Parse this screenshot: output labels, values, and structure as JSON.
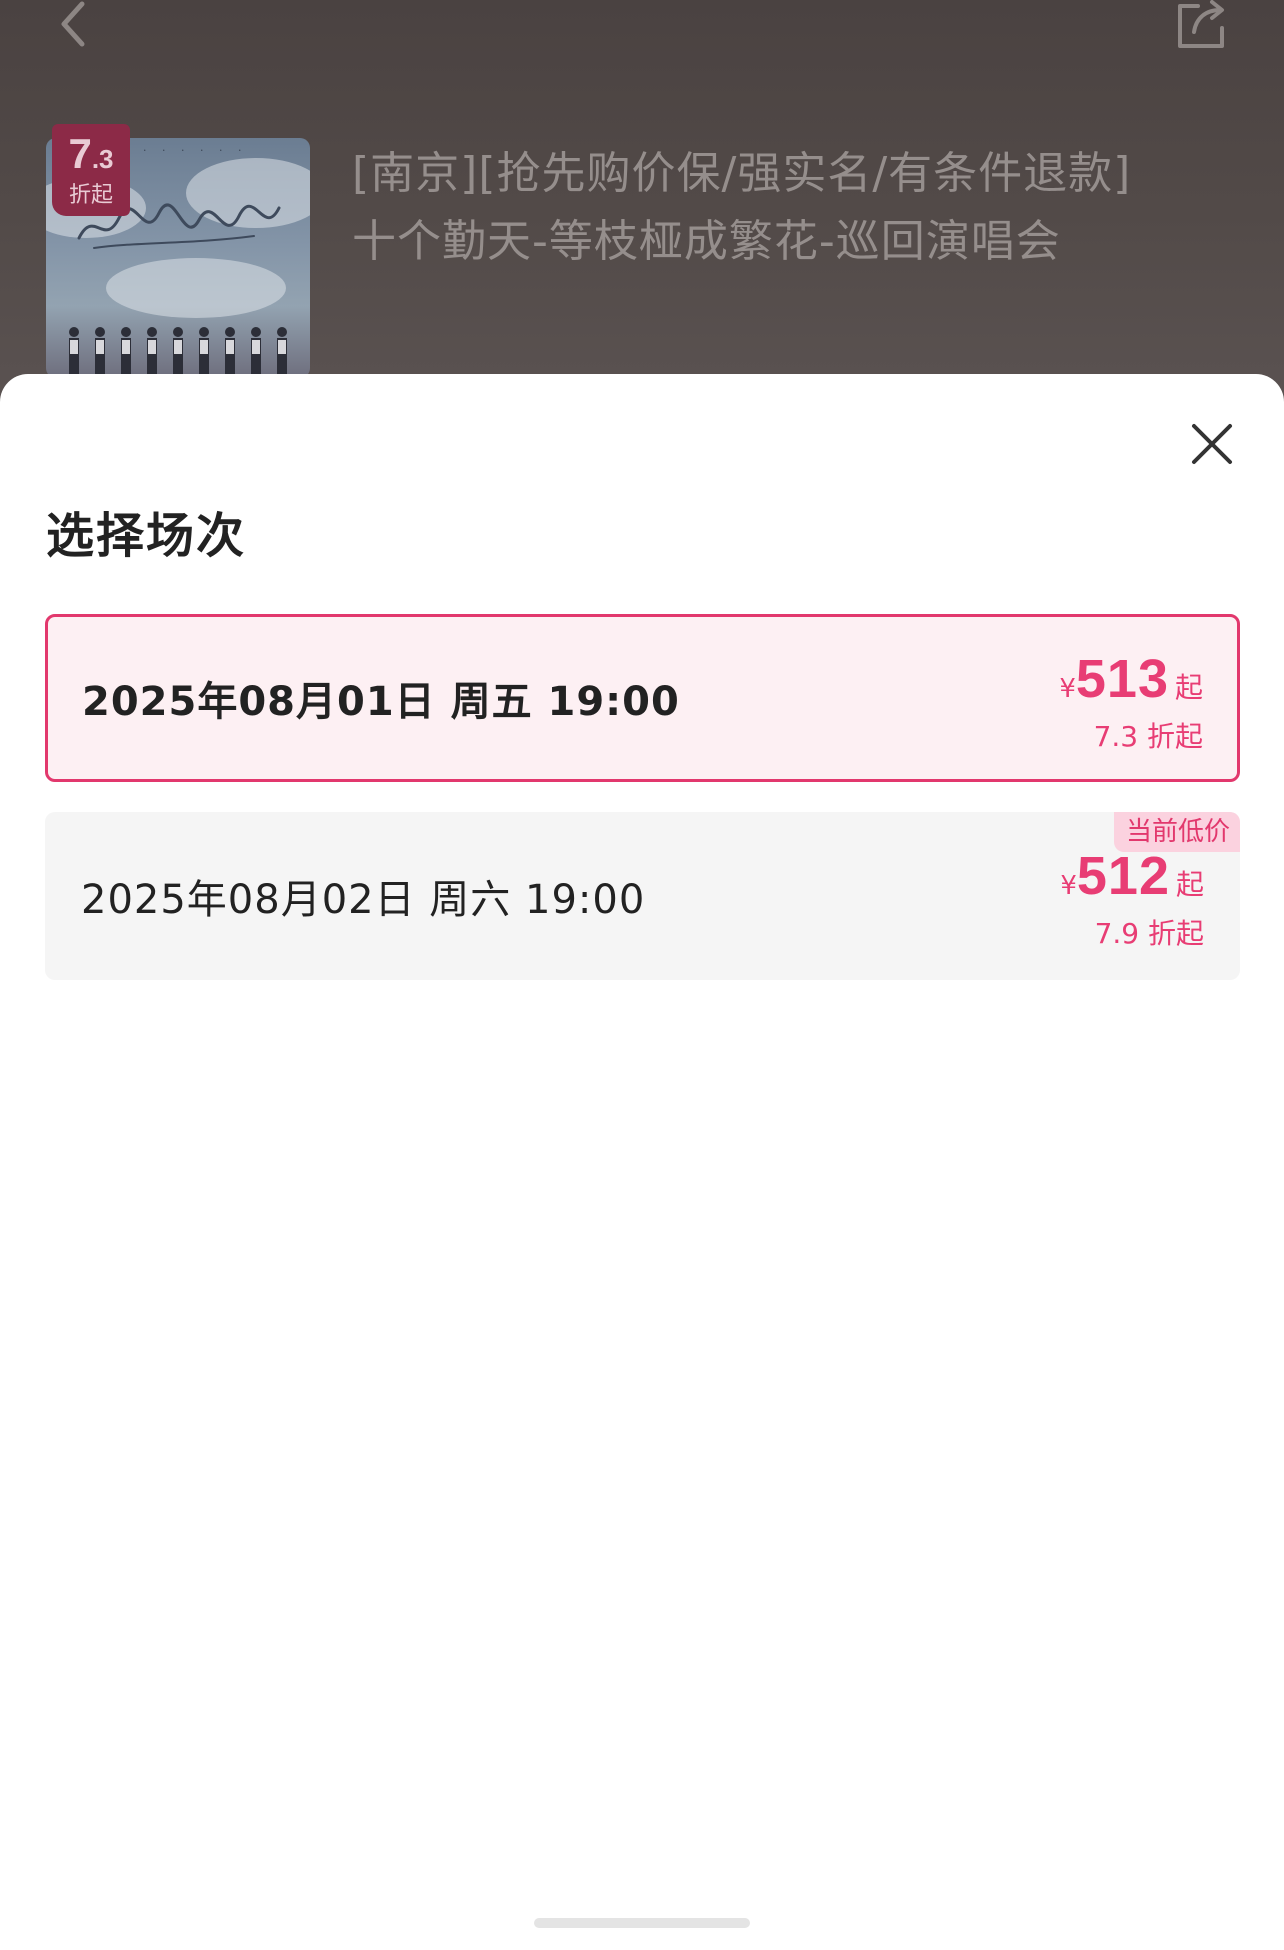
{
  "background": {
    "poster": {
      "discount_value": "7",
      "discount_decimal": ".3",
      "discount_unit": "折起"
    },
    "title_line1": "[南京][抢先购价保/强实名/有条件退款]",
    "title_line2": "十个勤天-等枝桠成繁花-巡回演唱会"
  },
  "sheet": {
    "title": "选择场次",
    "sessions": [
      {
        "date": "2025年08月01日 周五 19:00",
        "currency": "¥",
        "price": "513",
        "price_suffix": "起",
        "discount": "7.3 折起",
        "selected": true
      },
      {
        "date": "2025年08月02日 周六 19:00",
        "currency": "¥",
        "price": "512",
        "price_suffix": "起",
        "discount": "7.9 折起",
        "badge": "当前低价",
        "selected": false
      }
    ]
  },
  "colors": {
    "accent": "#e83d74",
    "selected_bg": "#fdf0f3",
    "selected_border": "#e2386d",
    "unselected_bg": "#f5f5f5",
    "badge_bg": "#fbd2df"
  },
  "icons": {
    "back": "chevron-left-icon",
    "share": "share-icon",
    "close": "close-icon"
  }
}
